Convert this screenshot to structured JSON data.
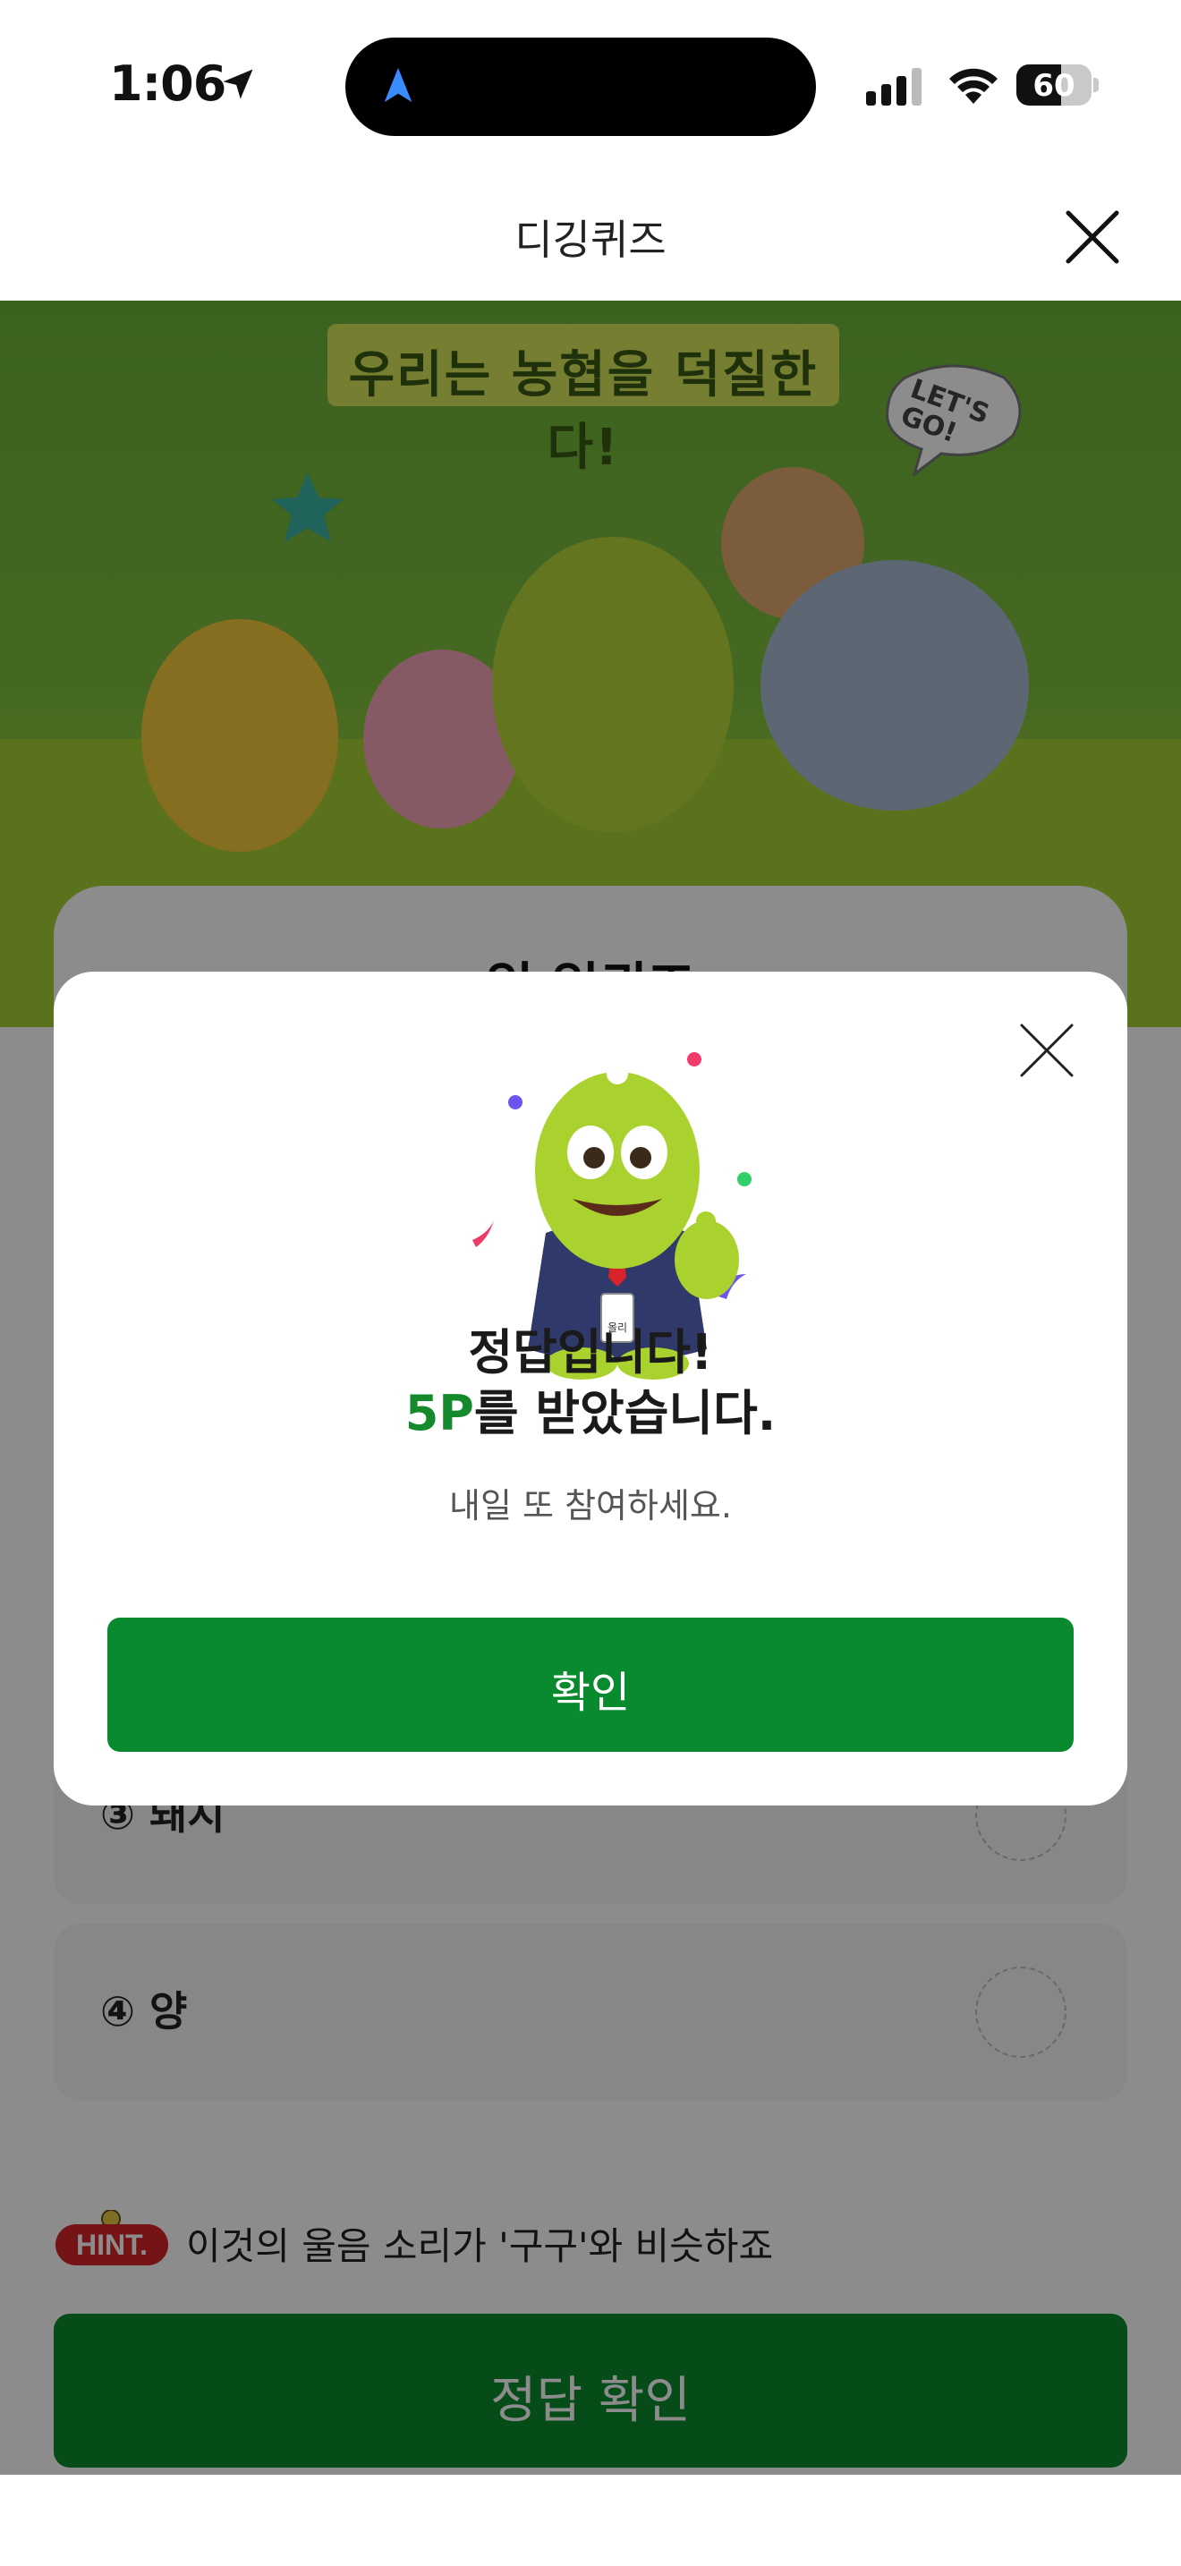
{
  "status_bar": {
    "time": "1:06",
    "battery": "60",
    "battery_level": 0.6,
    "icons": [
      "location-arrow-icon",
      "navigation-icon",
      "cellular-signal-icon",
      "wifi-icon",
      "battery-icon"
    ]
  },
  "header": {
    "title": "디깅퀴즈",
    "close_icon": "close-icon"
  },
  "banner": {
    "headline": "우리는 농협을 덕질한다!",
    "bubble_text": "LET'S GO!"
  },
  "quiz": {
    "options": [
      {
        "label": "③ 돼지"
      },
      {
        "label": "④ 양"
      }
    ],
    "hint_badge": "HINT.",
    "hint_text": "이것의 울음 소리가 '구구'와 비슷하죠",
    "submit_label": "정답 확인"
  },
  "modal": {
    "title": "정답입니다!",
    "points_value": "5P",
    "points_suffix": "를 받았습니다.",
    "subtitle": "내일 또 참여하세요.",
    "confirm_label": "확인",
    "mascot_badge": "올리"
  },
  "colors": {
    "primary_green": "#0a8a2e",
    "accent_green": "#158a2c",
    "banner_green": "#7fbf3d",
    "hint_red": "#d6262b"
  }
}
